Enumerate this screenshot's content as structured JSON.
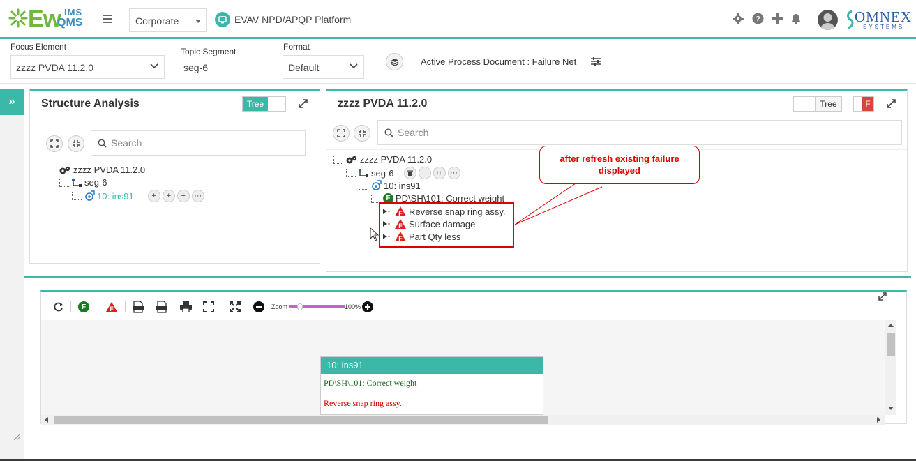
{
  "header": {
    "logo_ew": "Ew",
    "logo_ims": "IMS",
    "logo_qms": "QMS",
    "corporate": "Corporate",
    "platform": "EVAV NPD/APQP Platform",
    "brand_title": "OMNEX",
    "brand_sub": "SYSTEMS",
    "accent": "#3cb8a8"
  },
  "filters": {
    "focus_label": "Focus Element",
    "focus_value": "zzzz PVDA 11.2.0",
    "topic_label": "Topic Segment",
    "topic_value": "seg-6",
    "format_label": "Format",
    "format_value": "Default",
    "active_doc": "Active Process Document : Failure Net"
  },
  "left_panel": {
    "title": "Structure Analysis",
    "tree_toggle": "Tree",
    "search_placeholder": "Search",
    "tree": {
      "root": "zzzz PVDA 11.2.0",
      "seg": "seg-6",
      "ins": "10: ins91"
    },
    "ins_actions": [
      "+",
      "+",
      "+",
      "···"
    ]
  },
  "right_panel": {
    "title": "zzzz PVDA 11.2.0",
    "tree_toggle": "Tree",
    "f_toggle": "F",
    "search_placeholder": "Search",
    "tree": {
      "root": "zzzz PVDA 11.2.0",
      "seg": "seg-6",
      "ins": "10: ins91",
      "function": "PD\\SH\\101: Correct weight",
      "failures": [
        "Reverse snap ring assy.",
        "Surface damage",
        "Part Qty less"
      ]
    },
    "seg_actions": [
      "↑↓",
      "↑↓",
      "···"
    ],
    "callout": "after refresh existing failure displayed"
  },
  "diagram": {
    "zoom_label": "Zoom",
    "zoom_value": "100%",
    "zoom_level_percent": 100,
    "node_title": "10: ins91",
    "node_function": "PD\\SH\\101: Correct weight",
    "node_failure": "Reverse snap ring assy."
  }
}
